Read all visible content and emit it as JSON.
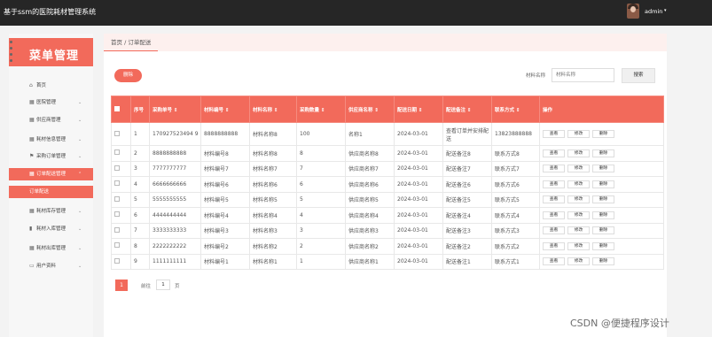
{
  "app": {
    "title": "基于ssm的医院耗材管理系统"
  },
  "header": {
    "username": "admin",
    "caret": "▾"
  },
  "sidebar": {
    "logo_text": "菜单管理",
    "items": [
      {
        "label": "首页",
        "icon": "⌂",
        "icon_name": "home-icon",
        "chevron": ""
      },
      {
        "label": "医院管理",
        "icon": "▦",
        "icon_name": "hospital-icon",
        "chevron": "⌄"
      },
      {
        "label": "供应商管理",
        "icon": "▦",
        "icon_name": "grid-icon",
        "chevron": "⌄"
      },
      {
        "label": "耗材信息管理",
        "icon": "▦",
        "icon_name": "grid-icon",
        "chevron": "⌄"
      },
      {
        "label": "采购订单管理",
        "icon": "⚑",
        "icon_name": "flag-icon",
        "chevron": "⌄"
      },
      {
        "label": "订单配送管理",
        "icon": "▦",
        "icon_name": "grid-icon",
        "chevron": "⌃"
      },
      {
        "label": "耗材库存管理",
        "icon": "▦",
        "icon_name": "grid-icon",
        "chevron": "⌄"
      },
      {
        "label": "耗材入库管理",
        "icon": "▮",
        "icon_name": "trash-icon",
        "chevron": "⌄"
      },
      {
        "label": "耗材出库管理",
        "icon": "▦",
        "icon_name": "grid-icon",
        "chevron": "⌄"
      },
      {
        "label": "用户资料",
        "icon": "▭",
        "icon_name": "user-card-icon",
        "chevron": "⌄"
      }
    ],
    "submenu_label": "订单配送"
  },
  "breadcrumb": {
    "text": "首页 / 订单配送"
  },
  "toolbar": {
    "delete_label": "删除",
    "search_label": "材料名称",
    "search_placeholder": "材料名称",
    "search_button": "搜索"
  },
  "table": {
    "headers": {
      "index": "序号",
      "order_no": "采购单号 ⇕",
      "material_no": "材料编号 ⇕",
      "material_name": "材料名称 ⇕",
      "quantity": "采购数量 ⇕",
      "supplier": "供应商名称 ⇕",
      "delivery_date": "配送日期 ⇕",
      "delivery_note": "配送备注 ⇕",
      "contact": "联系方式 ⇕",
      "actions": "操作"
    },
    "action_labels": {
      "view": "查看",
      "edit": "修改",
      "delete": "删除"
    },
    "rows": [
      {
        "idx": "1",
        "order": "170927523494 9",
        "mat_no": "8888888888",
        "mat_name": "材料名称8",
        "qty": "100",
        "supplier": "名称1",
        "date": "2024-03-01",
        "note": "查看订单并安排配送",
        "contact": "13823888888"
      },
      {
        "idx": "2",
        "order": "8888888888",
        "mat_no": "材料编号8",
        "mat_name": "材料名称8",
        "qty": "8",
        "supplier": "供应商名称8",
        "date": "2024-03-01",
        "note": "配送备注8",
        "contact": "联系方式8"
      },
      {
        "idx": "3",
        "order": "7777777777",
        "mat_no": "材料编号7",
        "mat_name": "材料名称7",
        "qty": "7",
        "supplier": "供应商名称7",
        "date": "2024-03-01",
        "note": "配送备注7",
        "contact": "联系方式7"
      },
      {
        "idx": "4",
        "order": "6666666666",
        "mat_no": "材料编号6",
        "mat_name": "材料名称6",
        "qty": "6",
        "supplier": "供应商名称6",
        "date": "2024-03-01",
        "note": "配送备注6",
        "contact": "联系方式6"
      },
      {
        "idx": "5",
        "order": "5555555555",
        "mat_no": "材料编号5",
        "mat_name": "材料名称5",
        "qty": "5",
        "supplier": "供应商名称5",
        "date": "2024-03-01",
        "note": "配送备注5",
        "contact": "联系方式5"
      },
      {
        "idx": "6",
        "order": "4444444444",
        "mat_no": "材料编号4",
        "mat_name": "材料名称4",
        "qty": "4",
        "supplier": "供应商名称4",
        "date": "2024-03-01",
        "note": "配送备注4",
        "contact": "联系方式4"
      },
      {
        "idx": "7",
        "order": "3333333333",
        "mat_no": "材料编号3",
        "mat_name": "材料名称3",
        "qty": "3",
        "supplier": "供应商名称3",
        "date": "2024-03-01",
        "note": "配送备注3",
        "contact": "联系方式3"
      },
      {
        "idx": "8",
        "order": "2222222222",
        "mat_no": "材料编号2",
        "mat_name": "材料名称2",
        "qty": "2",
        "supplier": "供应商名称2",
        "date": "2024-03-01",
        "note": "配送备注2",
        "contact": "联系方式2"
      },
      {
        "idx": "9",
        "order": "1111111111",
        "mat_no": "材料编号1",
        "mat_name": "材料名称1",
        "qty": "1",
        "supplier": "供应商名称1",
        "date": "2024-03-01",
        "note": "配送备注1",
        "contact": "联系方式1"
      }
    ]
  },
  "pagination": {
    "current_page": "1",
    "goto_label": "前往",
    "goto_value": "1",
    "unit_label": "页"
  },
  "watermark": "CSDN @便捷程序设计",
  "colors": {
    "accent": "#f26a5b",
    "topbar": "#262626"
  }
}
